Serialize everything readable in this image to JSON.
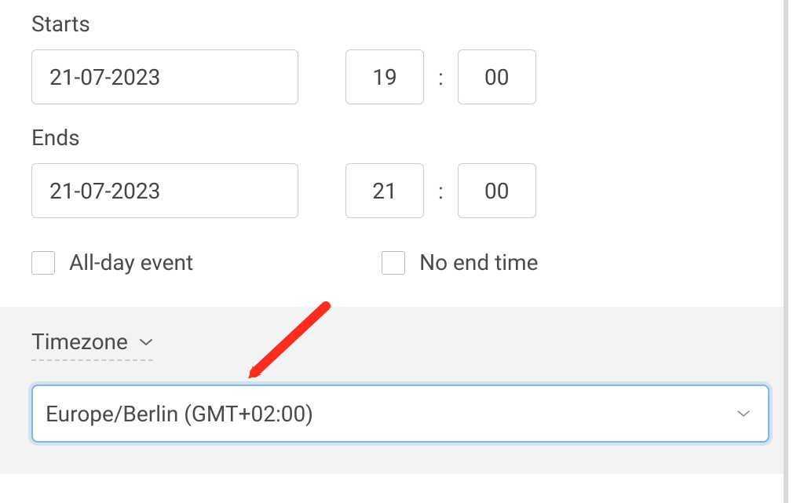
{
  "starts": {
    "label": "Starts",
    "date": "21-07-2023",
    "hour": "19",
    "minute": "00"
  },
  "ends": {
    "label": "Ends",
    "date": "21-07-2023",
    "hour": "21",
    "minute": "00"
  },
  "time_separator": ":",
  "options": {
    "all_day_label": "All-day event",
    "no_end_time_label": "No end time"
  },
  "timezone": {
    "header_label": "Timezone",
    "selected_value": "Europe/Berlin (GMT+02:00)"
  },
  "colors": {
    "arrow": "#ff2d1f",
    "focus_border": "#7fb5e8",
    "section_bg": "#f3f3f3"
  }
}
